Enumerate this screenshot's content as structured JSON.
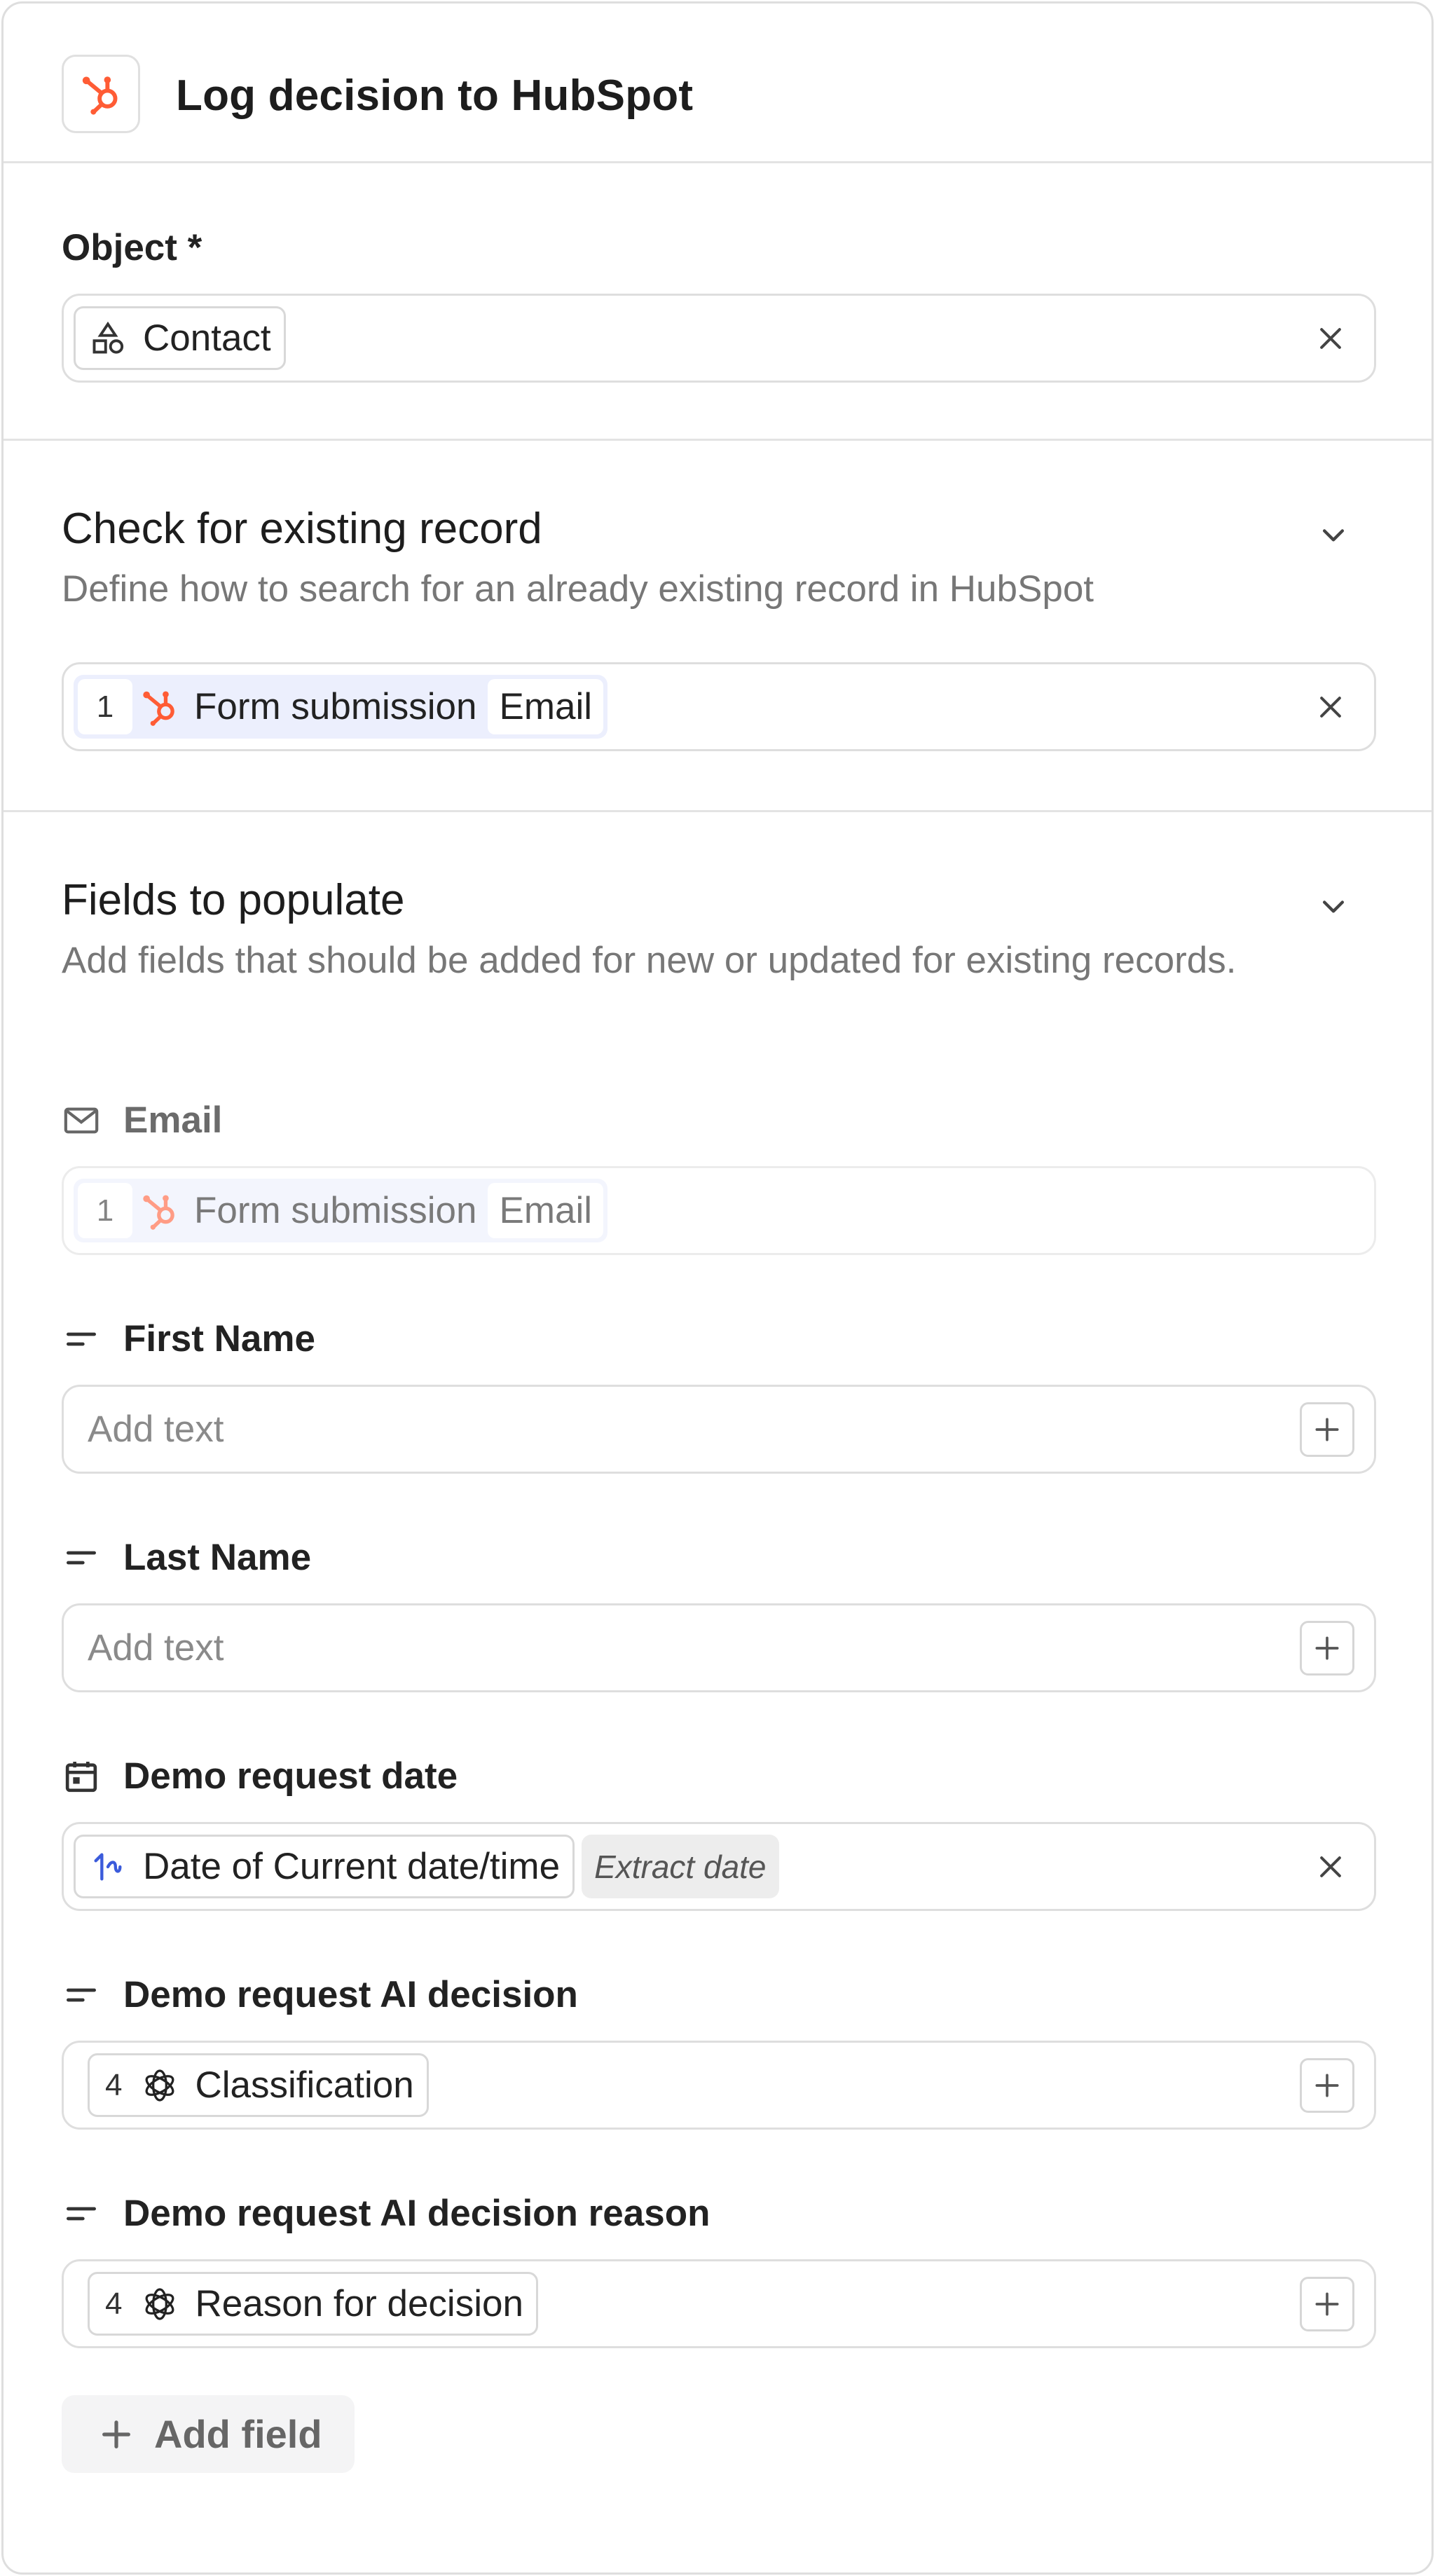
{
  "header": {
    "title": "Log decision to HubSpot",
    "icon": "hubspot-icon"
  },
  "object_section": {
    "label": "Object *",
    "value": "Contact",
    "value_icon": "shapes-icon"
  },
  "check_section": {
    "title": "Check for existing record",
    "description": "Define how to search for an already existing record in HubSpot",
    "ref": {
      "step": "1",
      "source": "Form submission",
      "field": "Email"
    }
  },
  "fields_section": {
    "title": "Fields to populate",
    "description": "Add fields that should be added for new or updated for existing records.",
    "fields": [
      {
        "label": "Email",
        "icon": "mail-icon",
        "ref": {
          "step": "1",
          "source": "Form submission",
          "field": "Email"
        }
      },
      {
        "label": "First Name",
        "icon": "text-icon",
        "placeholder": "Add text"
      },
      {
        "label": "Last Name",
        "icon": "text-icon",
        "placeholder": "Add text"
      },
      {
        "label": "Demo request date",
        "icon": "calendar-icon",
        "chip": "Date of Current date/time",
        "tag": "Extract date"
      },
      {
        "label": "Demo request AI decision",
        "icon": "text-icon",
        "step": "4",
        "chip": "Classification"
      },
      {
        "label": "Demo request AI decision reason",
        "icon": "text-icon",
        "step": "4",
        "chip": "Reason for decision"
      }
    ],
    "add_field_label": "Add field"
  },
  "colors": {
    "hubspot": "#ff5c35",
    "chip_ref_bg": "#eceffd",
    "accent_blue": "#3b5bdb"
  }
}
